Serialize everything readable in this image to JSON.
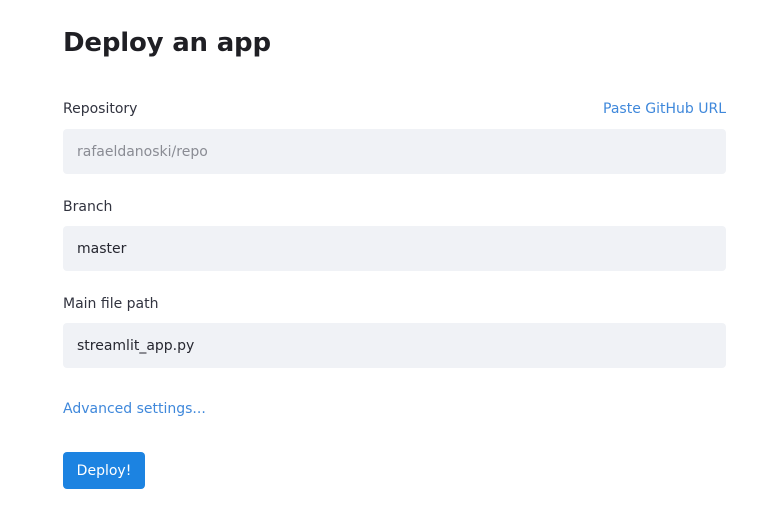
{
  "page": {
    "title": "Deploy an app"
  },
  "repository": {
    "label": "Repository",
    "paste_link": "Paste GitHub URL",
    "placeholder": "rafaeldanoski/repo",
    "value": ""
  },
  "branch": {
    "label": "Branch",
    "value": "master"
  },
  "main_file": {
    "label": "Main file path",
    "value": "streamlit_app.py"
  },
  "advanced": {
    "label": "Advanced settings..."
  },
  "deploy": {
    "label": "Deploy!"
  },
  "colors": {
    "accent": "#1c83e1",
    "link": "#3f88db",
    "input_bg": "#f0f2f6"
  }
}
